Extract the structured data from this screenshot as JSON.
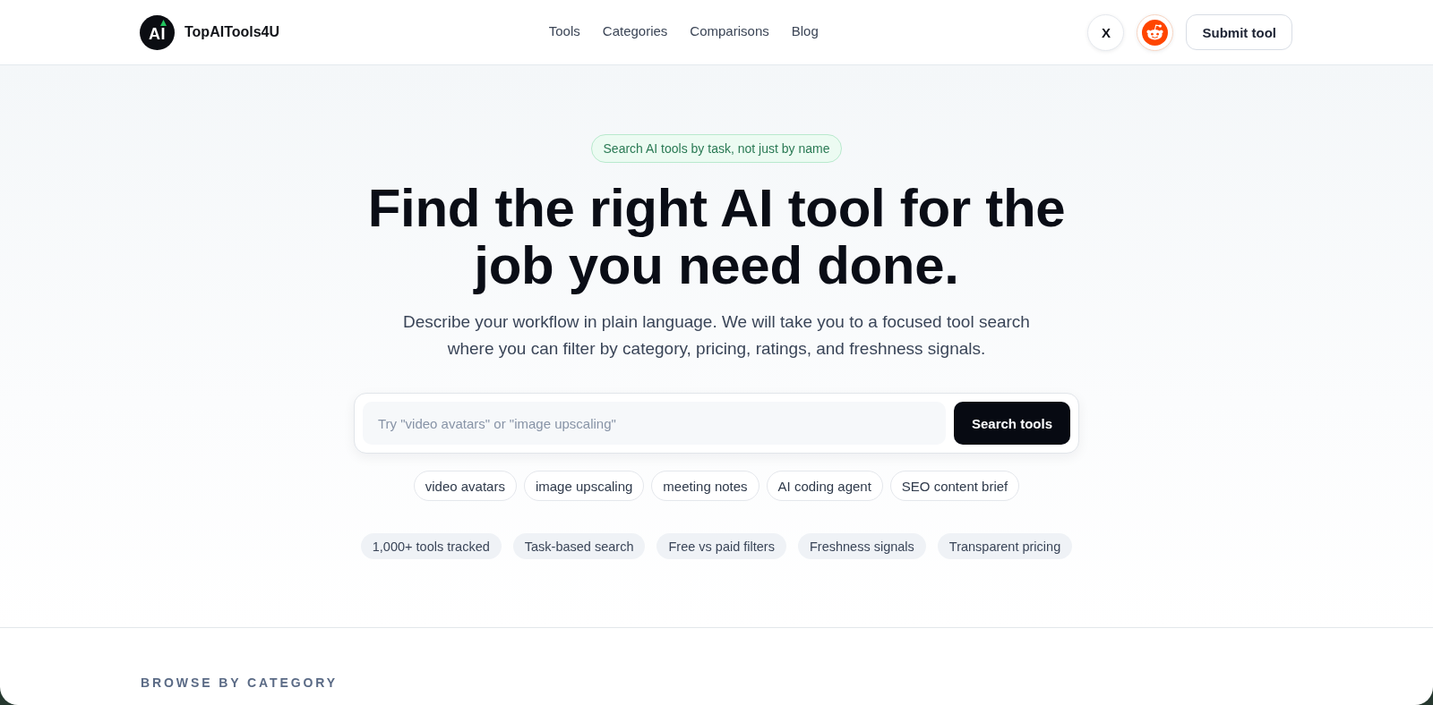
{
  "header": {
    "logo_mark": "AI",
    "brand": "TopAITools4U",
    "nav": [
      {
        "label": "Tools"
      },
      {
        "label": "Categories"
      },
      {
        "label": "Comparisons"
      },
      {
        "label": "Blog"
      }
    ],
    "social": [
      {
        "kind": "text",
        "label": "X"
      },
      {
        "kind": "alien"
      }
    ],
    "submit": "Submit tool"
  },
  "hero": {
    "badge": "Search AI tools by task, not just by name",
    "title": "Find the right AI tool for the job you need done.",
    "subtitle": "Describe your workflow in plain language. We will take you to a focused tool search where you can filter by category, pricing, ratings, and freshness signals.",
    "search": {
      "placeholder": "Try \"video avatars\" or \"image upscaling\"",
      "button": "Search tools"
    },
    "suggestions": [
      "video avatars",
      "image upscaling",
      "meeting notes",
      "AI coding agent",
      "SEO content brief"
    ],
    "highlights": [
      "1,000+ tools tracked",
      "Task-based search",
      "Free vs paid filters",
      "Freshness signals",
      "Transparent pricing"
    ]
  },
  "browse": {
    "heading": "BROWSE BY CATEGORY"
  }
}
